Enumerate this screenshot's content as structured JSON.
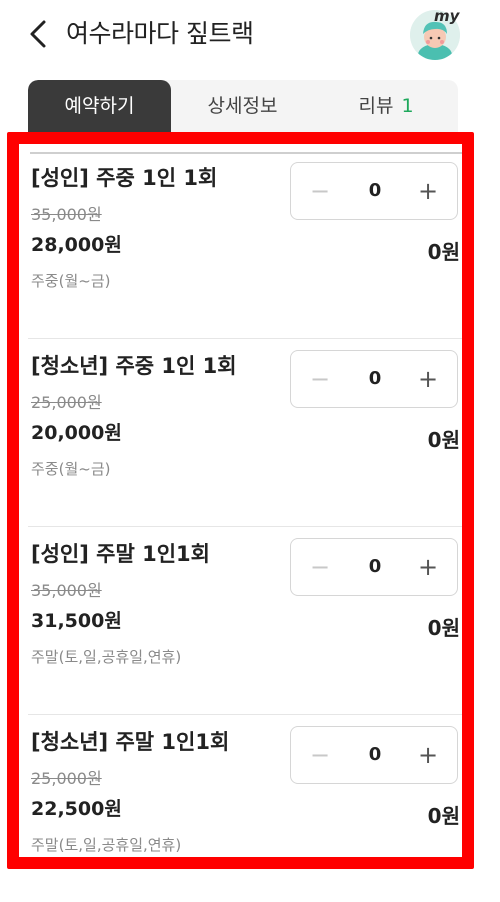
{
  "header": {
    "title": "여수라마다 짚트랙",
    "avatar_badge": "my"
  },
  "tabs": [
    {
      "label": "예약하기",
      "active": true
    },
    {
      "label": "상세정보",
      "active": false
    },
    {
      "label": "리뷰",
      "count": "1",
      "active": false
    }
  ],
  "items": [
    {
      "name": "[성인] 주중 1인 1회",
      "original_price": "35,000원",
      "price": "28,000원",
      "note": "주중(월~금)",
      "quantity": "0",
      "total": "0원"
    },
    {
      "name": "[청소년] 주중 1인 1회",
      "original_price": "25,000원",
      "price": "20,000원",
      "note": "주중(월~금)",
      "quantity": "0",
      "total": "0원"
    },
    {
      "name": "[성인] 주말 1인1회",
      "original_price": "35,000원",
      "price": "31,500원",
      "note": "주말(토,일,공휴일,연휴)",
      "quantity": "0",
      "total": "0원"
    },
    {
      "name": "[청소년] 주말 1인1회",
      "original_price": "25,000원",
      "price": "22,500원",
      "note": "주말(토,일,공휴일,연휴)",
      "quantity": "0",
      "total": "0원"
    }
  ],
  "stepper": {
    "minus": "−",
    "plus": "+"
  },
  "colors": {
    "accent_green": "#1ea85c",
    "tab_active_bg": "#3a3a3a",
    "highlight": "#ff0000"
  }
}
